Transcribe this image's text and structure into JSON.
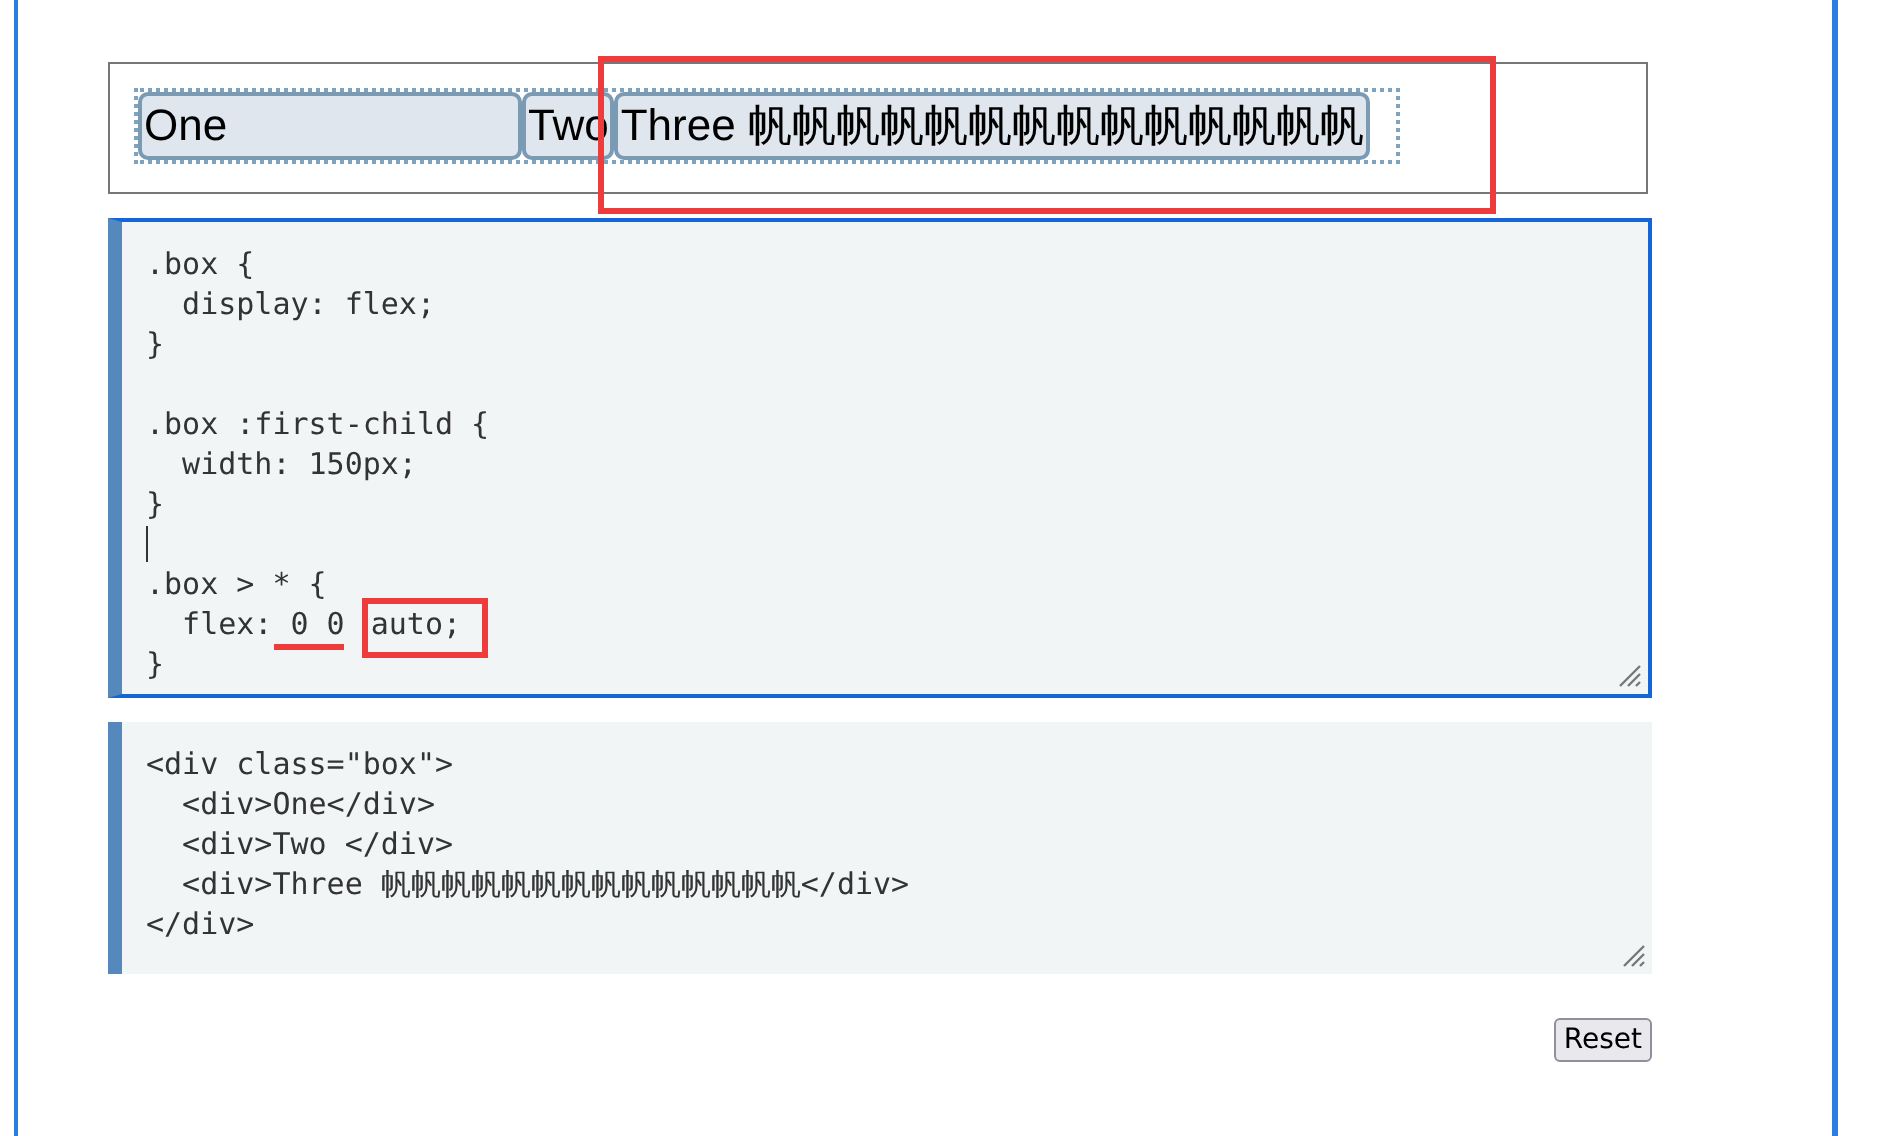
{
  "preview": {
    "items": [
      "One",
      "Two",
      "Three 帆帆帆帆帆帆帆帆帆帆帆帆帆帆"
    ]
  },
  "css_editor": {
    "rules": [
      {
        "lines": [
          ".box {",
          "  display: flex;",
          "}"
        ]
      },
      {
        "lines": [
          ".box :first-child {",
          "  width: 150px;",
          "}"
        ]
      },
      {
        "lines": [
          ".box > * {",
          [
            "  flex: ",
            {
              "text": "0 0",
              "kind": "underlined"
            },
            {
              "text": "auto;",
              "kind": "boxed"
            }
          ],
          "}"
        ]
      }
    ]
  },
  "html_editor": {
    "lines": [
      "<div class=\"box\">",
      "  <div>One</div>",
      "  <div>Two </div>",
      "  <div>Three 帆帆帆帆帆帆帆帆帆帆帆帆帆帆</div>",
      "</div>"
    ]
  },
  "reset_button": "Reset"
}
